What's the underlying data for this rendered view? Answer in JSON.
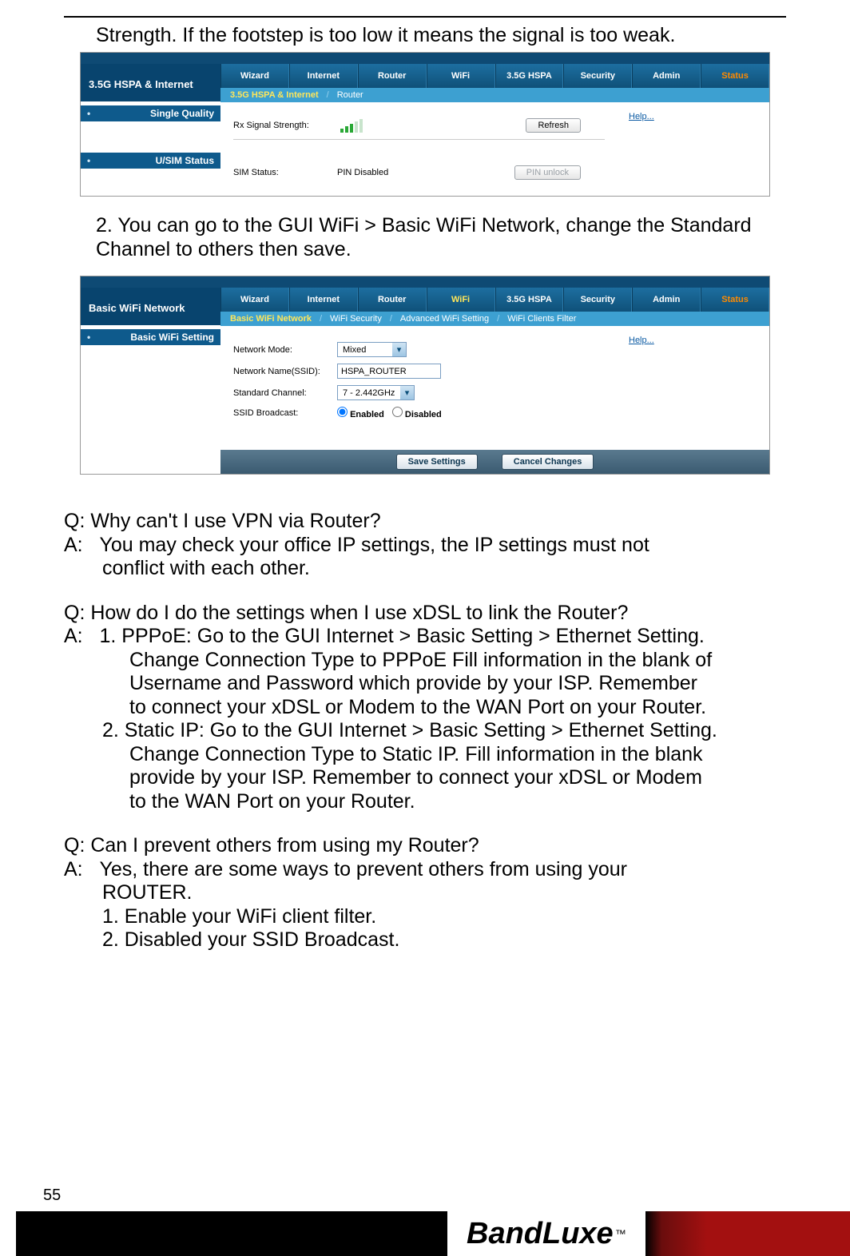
{
  "lead": "Strength. If the footstep is too low it means the signal is too weak.",
  "shot1": {
    "side_title": "3.5G HSPA & Internet",
    "side_items": [
      "Single Quality",
      "U/SIM Status"
    ],
    "tabs": [
      "Wizard",
      "Internet",
      "Router",
      "WiFi",
      "3.5G HSPA",
      "Security",
      "Admin",
      "Status"
    ],
    "subtabs": [
      "3.5G HSPA & Internet",
      "Router"
    ],
    "rx_label": "Rx Signal Strength:",
    "refresh": "Refresh",
    "help": "Help...",
    "sim_label": "SIM Status:",
    "sim_value": "PIN Disabled",
    "pin_unlock": "PIN unlock"
  },
  "step2": "2. You can go to the GUI WiFi > Basic WiFi Network, change the Standard Channel to others then save.",
  "shot2": {
    "side_title": "Basic WiFi Network",
    "side_items": [
      "Basic WiFi Setting"
    ],
    "tabs": [
      "Wizard",
      "Internet",
      "Router",
      "WiFi",
      "3.5G HSPA",
      "Security",
      "Admin",
      "Status"
    ],
    "subtabs": [
      "Basic WiFi Network",
      "WiFi Security",
      "Advanced WiFi Setting",
      "WiFi Clients Filter"
    ],
    "help": "Help...",
    "fields": {
      "mode_label": "Network Mode:",
      "mode_value": "Mixed",
      "ssid_label": "Network Name(SSID):",
      "ssid_value": "HSPA_ROUTER",
      "chan_label": "Standard Channel:",
      "chan_value": "7 - 2.442GHz",
      "bcast_label": "SSID Broadcast:",
      "enabled": "Enabled",
      "disabled": "Disabled"
    },
    "save": "Save Settings",
    "cancel": "Cancel Changes"
  },
  "q1": "Q: Why can't I use VPN via Router?",
  "a1_prefix": "A:",
  "a1": "You may check your office IP settings, the IP settings must not conflict with each other.",
  "q2": "Q: How do I do the settings when I use xDSL to link the Router?",
  "a2_prefix": "A:",
  "a2_1": "1. PPPoE: Go to the GUI Internet > Basic Setting > Ethernet Setting. Change Connection Type to PPPoE Fill information in the blank of Username and Password which provide by your ISP. Remember to connect your xDSL or Modem to the WAN Port on your Router.",
  "a2_2": "2. Static IP: Go to the GUI Internet > Basic Setting > Ethernet Setting. Change Connection Type to Static IP. Fill information in the blank provide by your ISP. Remember to connect your xDSL or Modem to the WAN Port on your Router.",
  "q3": "Q: Can I prevent others from using my Router?",
  "a3_prefix": "A:",
  "a3": "Yes, there are some ways to prevent others from using your ROUTER.",
  "a3_1": "1. Enable your WiFi client filter.",
  "a3_2": "2. Disabled your SSID Broadcast.",
  "page_num": "55",
  "brand": "BandLuxe",
  "tm": "™"
}
